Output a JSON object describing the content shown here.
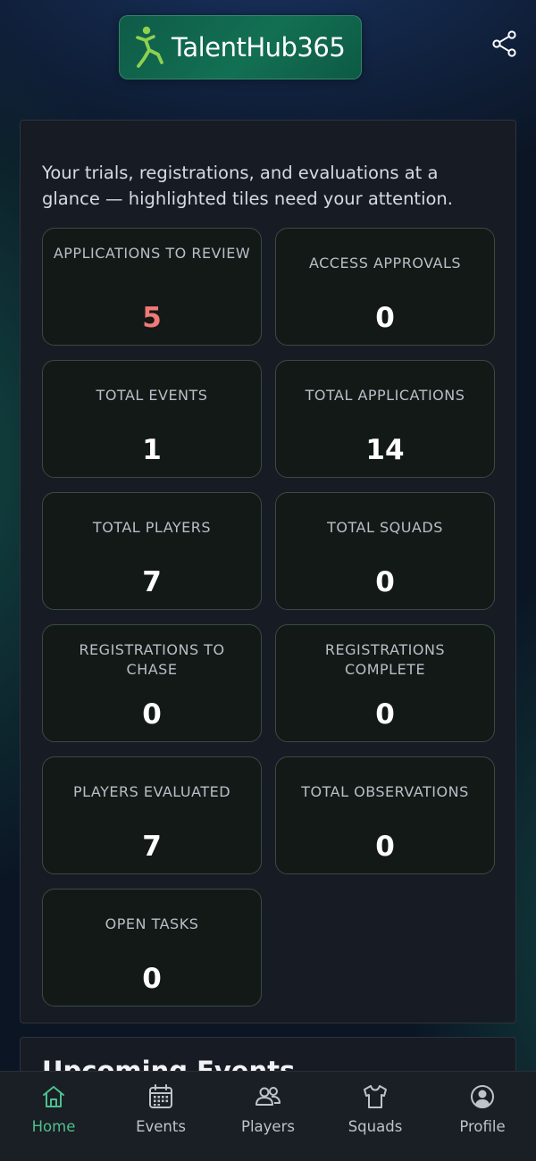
{
  "header": {
    "logo_text": "TalentHub365",
    "share_icon": "share-icon"
  },
  "intro": "Your trials, registrations, and evaluations at a glance — highlighted tiles need your attention.",
  "tiles": [
    {
      "label": "APPLICATIONS TO REVIEW",
      "value": "5",
      "highlight": true
    },
    {
      "label": "ACCESS APPROVALS",
      "value": "0",
      "highlight": false
    },
    {
      "label": "TOTAL EVENTS",
      "value": "1",
      "highlight": false
    },
    {
      "label": "TOTAL APPLICATIONS",
      "value": "14",
      "highlight": false
    },
    {
      "label": "TOTAL PLAYERS",
      "value": "7",
      "highlight": false
    },
    {
      "label": "TOTAL SQUADS",
      "value": "0",
      "highlight": false
    },
    {
      "label": "REGISTRATIONS TO CHASE",
      "value": "0",
      "highlight": false
    },
    {
      "label": "REGISTRATIONS COMPLETE",
      "value": "0",
      "highlight": false
    },
    {
      "label": "PLAYERS EVALUATED",
      "value": "7",
      "highlight": false
    },
    {
      "label": "TOTAL OBSERVATIONS",
      "value": "0",
      "highlight": false
    },
    {
      "label": "OPEN TASKS",
      "value": "0",
      "highlight": false
    }
  ],
  "upcoming": {
    "title": "Upcoming Events"
  },
  "nav": [
    {
      "label": "Home",
      "icon": "home-icon",
      "active": true
    },
    {
      "label": "Events",
      "icon": "calendar-icon",
      "active": false
    },
    {
      "label": "Players",
      "icon": "users-icon",
      "active": false
    },
    {
      "label": "Squads",
      "icon": "shirt-icon",
      "active": false
    },
    {
      "label": "Profile",
      "icon": "profile-icon",
      "active": false
    }
  ],
  "colors": {
    "accent": "#4dc08c",
    "highlight_value": "#f07a78",
    "background": "#0b1524"
  }
}
